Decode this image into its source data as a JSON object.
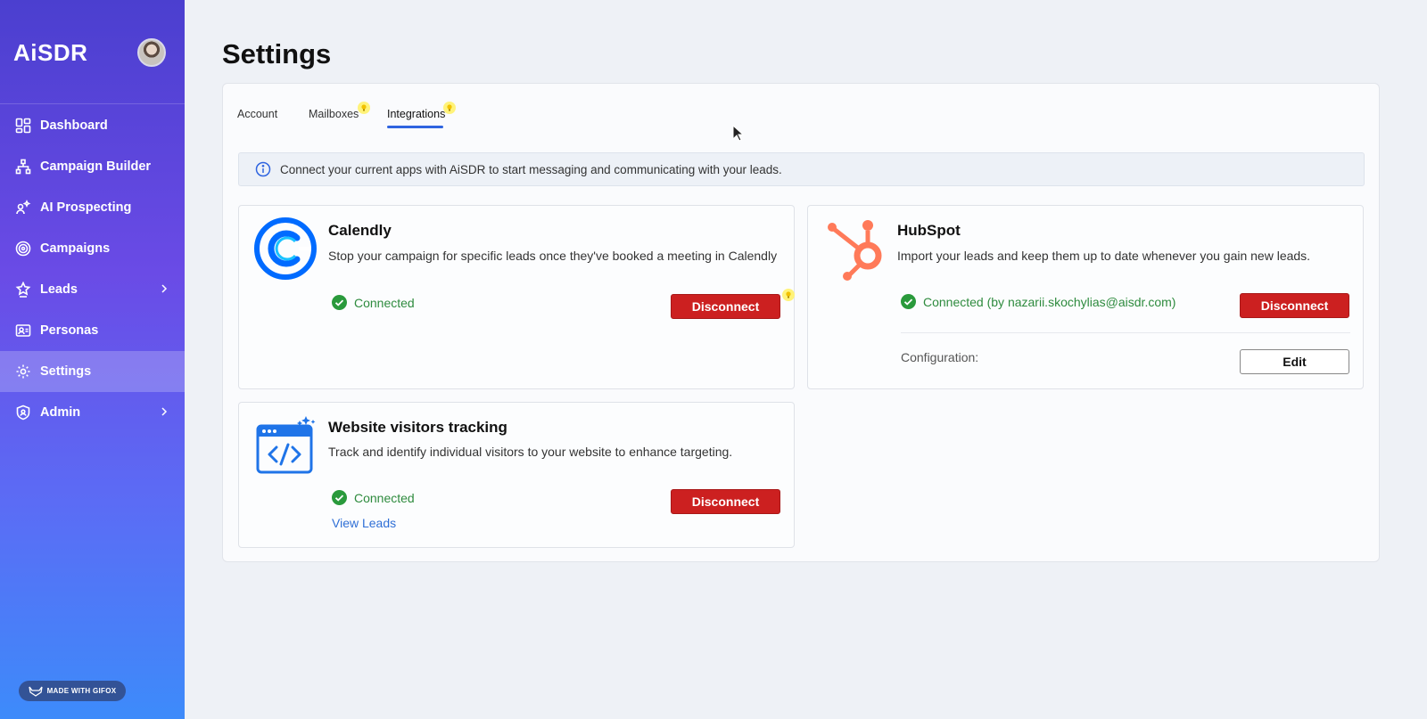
{
  "sidebar": {
    "brand": "AiSDR",
    "items": [
      {
        "label": "Dashboard",
        "icon": "dashboard-icon"
      },
      {
        "label": "Campaign Builder",
        "icon": "campaign-builder-icon"
      },
      {
        "label": "AI Prospecting",
        "icon": "ai-prospecting-icon"
      },
      {
        "label": "Campaigns",
        "icon": "target-icon"
      },
      {
        "label": "Leads",
        "icon": "star-person-icon"
      },
      {
        "label": "Personas",
        "icon": "persona-card-icon"
      },
      {
        "label": "Settings",
        "icon": "gear-icon",
        "active": true
      },
      {
        "label": "Admin",
        "icon": "shield-icon"
      }
    ],
    "gifox_badge": "MADE WITH GIFOX"
  },
  "page": {
    "title": "Settings",
    "tabs": [
      {
        "label": "Account"
      },
      {
        "label": "Mailboxes"
      },
      {
        "label": "Integrations",
        "active": true
      }
    ],
    "info_text": "Connect your current apps with AiSDR to start messaging and communicating with your leads."
  },
  "integrations": {
    "calendly": {
      "title": "Calendly",
      "description": "Stop your campaign for specific leads once they've booked a meeting in Calendly",
      "status": "Connected",
      "button": "Disconnect"
    },
    "hubspot": {
      "title": "HubSpot",
      "description": "Import your leads and keep them up to date whenever you gain new leads.",
      "status": "Connected (by nazarii.skochylias@aisdr.com)",
      "button": "Disconnect",
      "config_label": "Configuration:",
      "config_button": "Edit"
    },
    "website": {
      "title": "Website visitors tracking",
      "description": "Track and identify individual visitors to your website to enhance targeting.",
      "status": "Connected",
      "button": "Disconnect",
      "link": "View Leads"
    }
  },
  "colors": {
    "accent": "#2f64e0",
    "danger": "#cc2020",
    "success": "#2e8b3e",
    "hubspot": "#ff7a59",
    "calendly": "#006bff"
  }
}
